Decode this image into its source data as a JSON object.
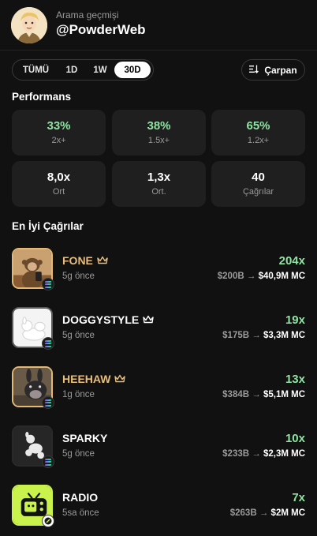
{
  "header": {
    "subtitle": "Arama geçmişi",
    "username": "@PowderWeb"
  },
  "filters": {
    "tabs": [
      {
        "label": "TÜMÜ",
        "active": false
      },
      {
        "label": "1D",
        "active": false
      },
      {
        "label": "1W",
        "active": false
      },
      {
        "label": "30D",
        "active": true
      }
    ],
    "multiplier_label": "Çarpan"
  },
  "performance": {
    "title": "Performans",
    "cards": [
      {
        "value": "33%",
        "label": "2x+",
        "highlight": true
      },
      {
        "value": "38%",
        "label": "1.5x+",
        "highlight": true
      },
      {
        "value": "65%",
        "label": "1.2x+",
        "highlight": true
      },
      {
        "value": "8,0x",
        "label": "Ort",
        "highlight": false
      },
      {
        "value": "1,3x",
        "label": "Ort.",
        "highlight": false
      },
      {
        "value": "40",
        "label": "Çağrılar",
        "highlight": false
      }
    ]
  },
  "best_calls": {
    "title": "En İyi Çağrılar",
    "items": [
      {
        "name": "FONE",
        "crown": true,
        "ago": "5g önce",
        "multiplier": "204x",
        "mc_from": "$200B",
        "arrow": "→",
        "mc_to": "$40,9M MC",
        "chain": "solana"
      },
      {
        "name": "DOGGYSTYLE",
        "crown": true,
        "ago": "5g önce",
        "multiplier": "19x",
        "mc_from": "$175B",
        "arrow": "→",
        "mc_to": "$3,3M MC",
        "chain": "solana"
      },
      {
        "name": "HEEHAW",
        "crown": true,
        "ago": "1g önce",
        "multiplier": "13x",
        "mc_from": "$384B",
        "arrow": "→",
        "mc_to": "$5,1M MC",
        "chain": "solana"
      },
      {
        "name": "SPARKY",
        "crown": false,
        "ago": "5g önce",
        "multiplier": "10x",
        "mc_from": "$233B",
        "arrow": "→",
        "mc_to": "$2,3M MC",
        "chain": "solana"
      },
      {
        "name": "RADIO",
        "crown": false,
        "ago": "5sa önce",
        "multiplier": "7x",
        "mc_from": "$263B",
        "arrow": "→",
        "mc_to": "$2M MC",
        "chain": "other"
      }
    ]
  },
  "colors": {
    "positive": "#8ee3a1",
    "gold": "#e8be7c",
    "card_bg": "#1f1f1f",
    "background": "#111111"
  }
}
